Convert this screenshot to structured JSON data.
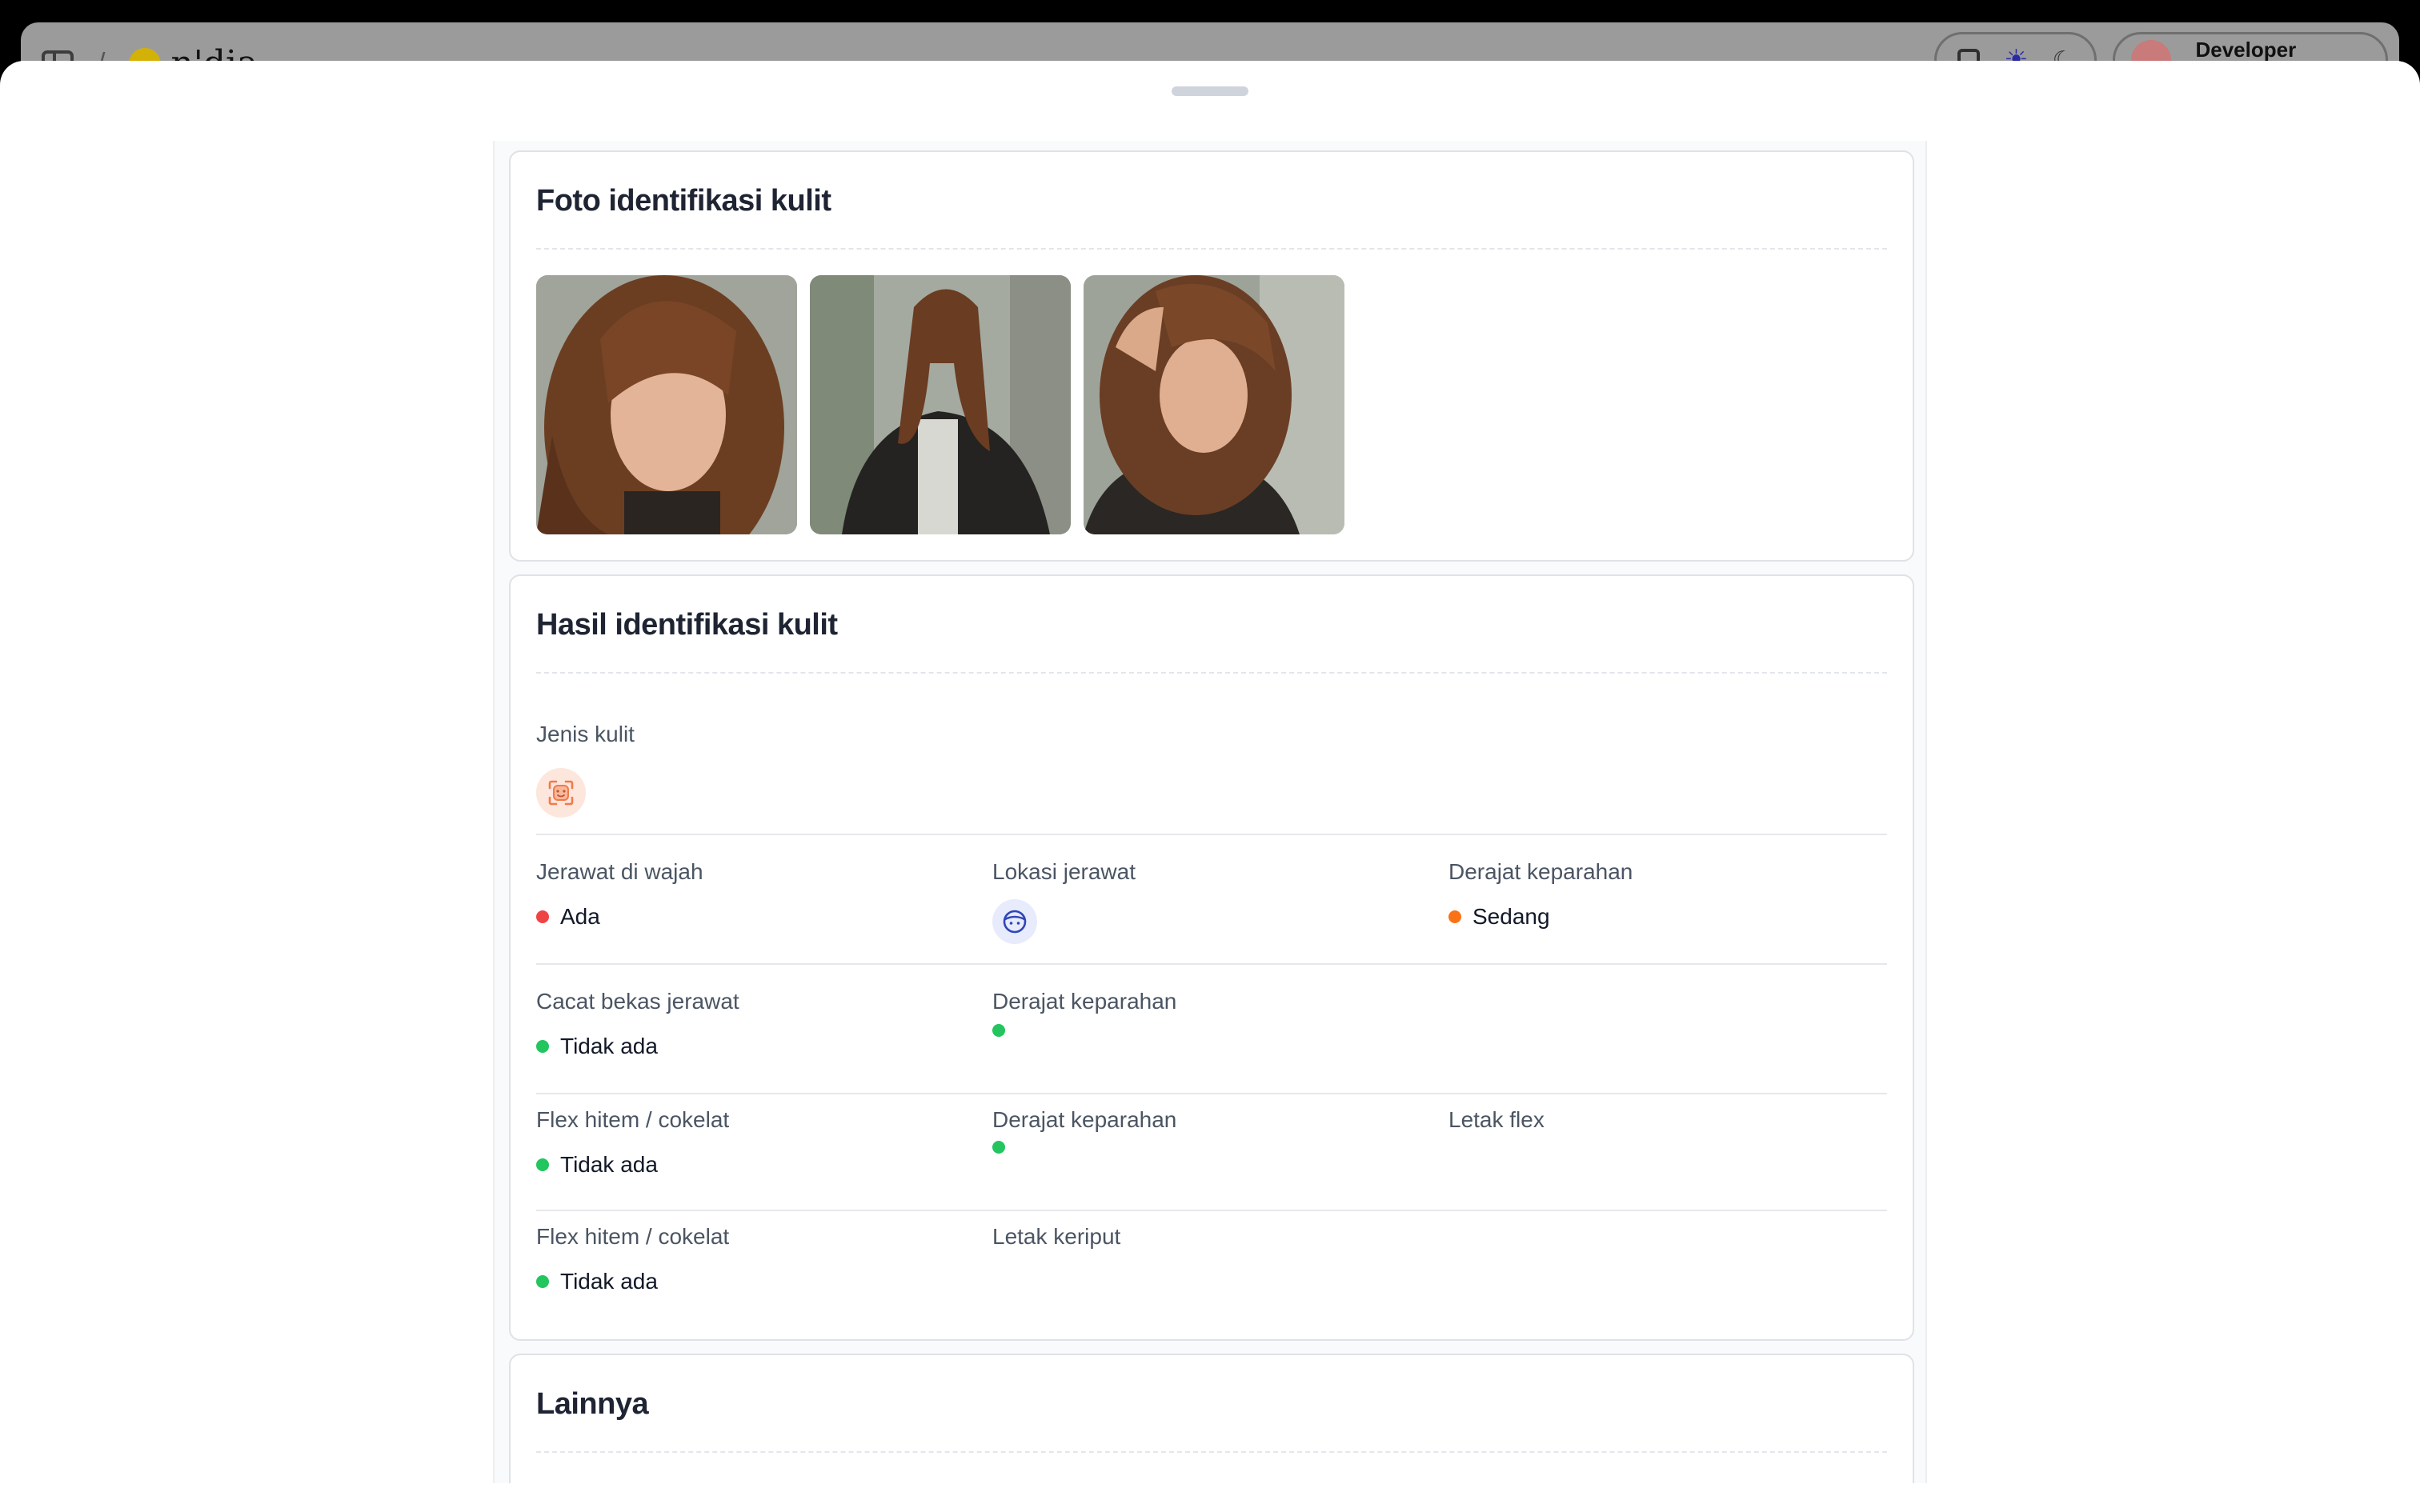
{
  "background_app": {
    "logo_text": "n'dia",
    "user_label": "Developer"
  },
  "photos_section": {
    "title": "Foto identifikasi kulit",
    "photos": [
      {
        "name": "skin-photo-1"
      },
      {
        "name": "skin-photo-2"
      },
      {
        "name": "skin-photo-3"
      }
    ]
  },
  "results_section": {
    "title": "Hasil identifikasi kulit",
    "skin_type": {
      "label": "Jenis kulit",
      "icon": "face-scan-icon"
    },
    "rows": [
      {
        "items": [
          {
            "label": "Jerawat di wajah",
            "value": "Ada",
            "status_color": "#ef4444"
          },
          {
            "label": "Lokasi jerawat",
            "icon": "face-icon"
          },
          {
            "label": "Derajat keparahan",
            "value": "Sedang",
            "status_color": "#f97316"
          }
        ]
      },
      {
        "items": [
          {
            "label": "Cacat bekas jerawat",
            "value": "Tidak ada",
            "status_color": "#22c55e"
          },
          {
            "label": "Derajat keparahan",
            "value": "",
            "status_color": "#22c55e"
          }
        ]
      },
      {
        "items": [
          {
            "label": "Flex hitem / cokelat",
            "value": "Tidak ada",
            "status_color": "#22c55e"
          },
          {
            "label": "Derajat keparahan",
            "value": "",
            "status_color": "#22c55e"
          },
          {
            "label": "Letak flex"
          }
        ]
      },
      {
        "items": [
          {
            "label": "Flex hitem / cokelat",
            "value": "Tidak ada",
            "status_color": "#22c55e"
          },
          {
            "label": "Letak keriput"
          }
        ]
      }
    ]
  },
  "other_section": {
    "title": "Lainnya"
  }
}
